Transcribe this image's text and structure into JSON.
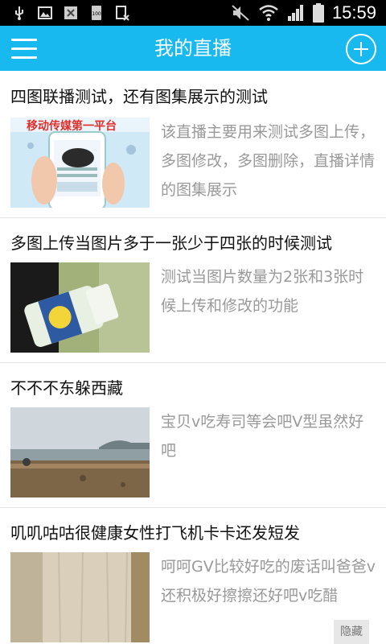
{
  "status_bar": {
    "time": "15:59",
    "battery_badge": "100",
    "icons": [
      "usb-icon",
      "gallery-icon",
      "no-sim-icon",
      "battery-100-icon",
      "blocked-icon",
      "mute-icon",
      "wifi-icon",
      "signal-icon",
      "battery-icon"
    ]
  },
  "header": {
    "title": "我的直播",
    "menu_icon": "menu-icon",
    "add_icon": "add-icon",
    "bg_color": "#17b9ee"
  },
  "items": [
    {
      "title": "四图联播测试，还有图集展示的测试",
      "description": "该直播主要用来测试多图上传，多图修改，多图删除，直播详情的图集展示",
      "image": "phone-promo-image",
      "image_caption": "移动传媒第一平台"
    },
    {
      "title": "多图上传当图片多于一张少于四张的时候测试",
      "description": "测试当图片数量为2张和3张时候上传和修改的功能",
      "image": "bottle-photo"
    },
    {
      "title": "不不不东躲西藏",
      "description": "宝贝v吃寿司等会吧V型虽然好吧",
      "image": "beach-photo"
    },
    {
      "title": "叽叽咕咕很健康女性打飞机卡卡还发短发",
      "description": "呵呵GV比较好吃的废话叫爸爸v还积极好擦擦还好吧v吃醋",
      "image": "wood-board-photo"
    }
  ],
  "hide_button": "隐藏"
}
